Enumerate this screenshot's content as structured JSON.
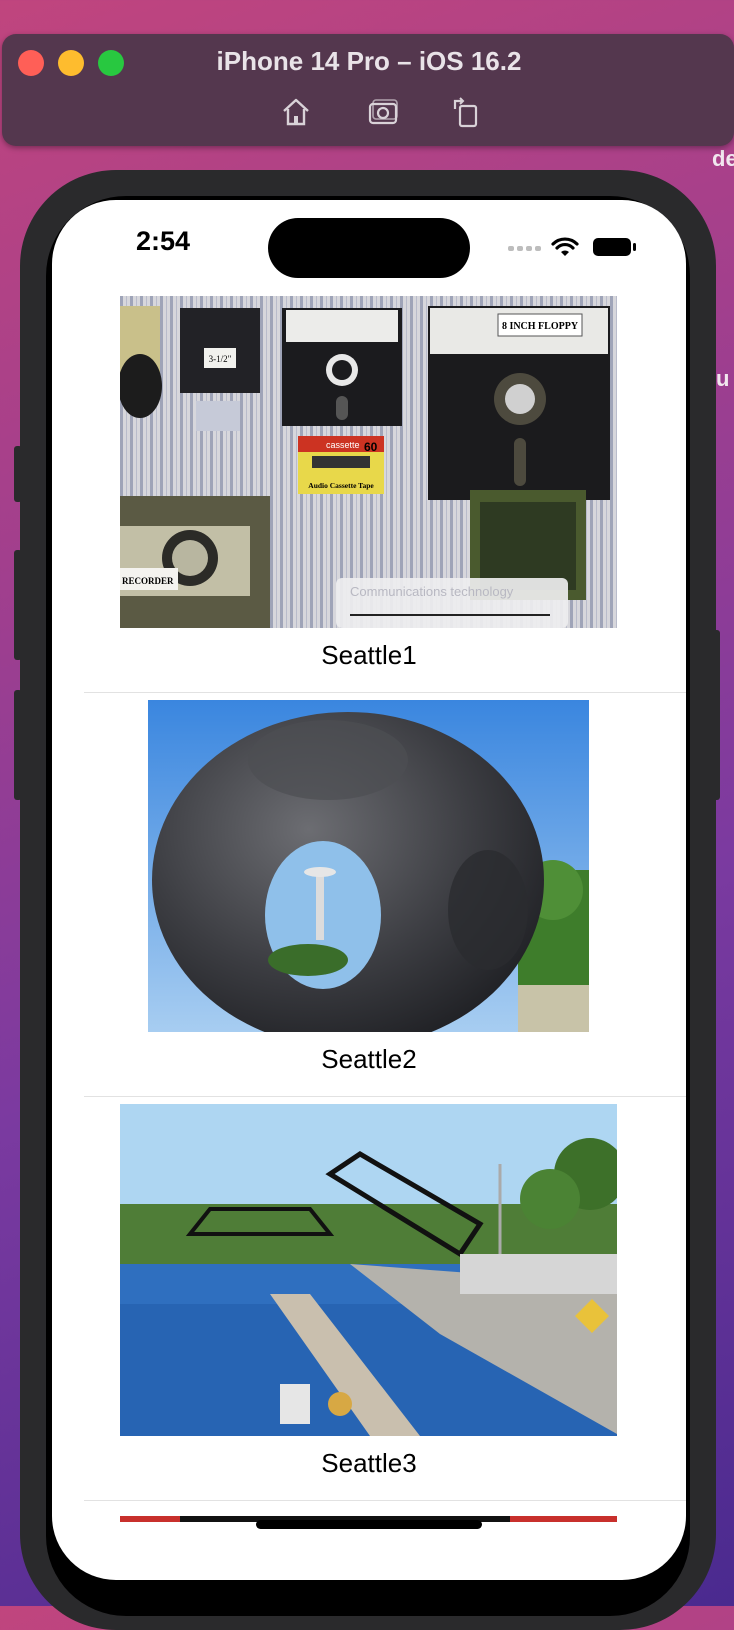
{
  "simulator": {
    "title": "iPhone 14 Pro – iOS 16.2",
    "buttons": [
      "home-icon",
      "screenshot-icon",
      "rotate-icon"
    ]
  },
  "background_text": [
    "de",
    "u"
  ],
  "status_bar": {
    "time": "2:54"
  },
  "rows": [
    {
      "caption": "Seattle1"
    },
    {
      "caption": "Seattle2"
    },
    {
      "caption": "Seattle3"
    }
  ],
  "photo_text": {
    "floppy_small": "3-1/2\"",
    "floppy_large": "8 INCH FLOPPY",
    "cassette": "Audio Cassette Tape",
    "cassette_brand": "cassette",
    "cassette_len": "60",
    "recorder": "RECORDER",
    "placard": "Communications technology"
  },
  "colors": {
    "desktop": "#a23f8d",
    "sim_bar": "#54374e",
    "close": "#ff5f57",
    "minimize": "#febc2e",
    "zoom": "#28c840"
  }
}
